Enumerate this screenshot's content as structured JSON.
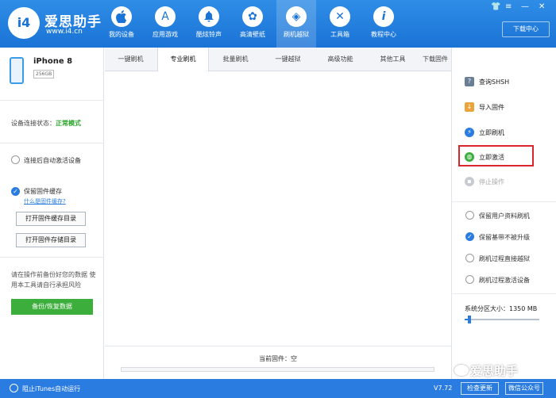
{
  "app": {
    "brand_name": "爱思助手",
    "brand_url": "www.i4.cn",
    "logo_text": "i4"
  },
  "nav": {
    "items": [
      {
        "label": "我的设备",
        "icon": "apple-icon",
        "glyph": ""
      },
      {
        "label": "应用游戏",
        "icon": "app-store-icon",
        "glyph": "A"
      },
      {
        "label": "酷炫铃声",
        "icon": "bell-icon",
        "glyph": "🔔"
      },
      {
        "label": "高清壁纸",
        "icon": "flower-icon",
        "glyph": "✿"
      },
      {
        "label": "刷机越狱",
        "icon": "dropbox-icon",
        "glyph": "◈"
      },
      {
        "label": "工具箱",
        "icon": "tools-icon",
        "glyph": "✕"
      },
      {
        "label": "教程中心",
        "icon": "info-icon",
        "glyph": "i"
      }
    ],
    "active_index": 4,
    "download_center": "下载中心"
  },
  "device": {
    "name": "iPhone 8",
    "storage": "256GB",
    "connection_label": "设备连接状态：",
    "connection_status": "正常模式"
  },
  "left_panel": {
    "auto_activate_label": "连接后自动激活设备",
    "keep_firmware_label": "保留固件缓存",
    "what_is_cache_link": "什么是固件缓存?",
    "open_cache_dir_button": "打开固件缓存目录",
    "open_storage_dir_button": "打开固件存储目录",
    "warning_text": "请在操作前备份好您的数据 使用本工具请自行承担风险",
    "backup_button": "备份/恢复数据"
  },
  "tabs": {
    "items": [
      "一键刷机",
      "专业刷机",
      "批量刷机",
      "一键越狱",
      "高级功能",
      "其他工具",
      "下载固件"
    ],
    "active_index": 1
  },
  "center": {
    "current_firmware_label": "当前固件：空",
    "progress": 0
  },
  "right_panel": {
    "actions": [
      {
        "label": "查询SHSH",
        "icon": "search-shsh-icon"
      },
      {
        "label": "导入固件",
        "icon": "import-icon"
      },
      {
        "label": "立即刷机",
        "icon": "flash-icon"
      },
      {
        "label": "立即激活",
        "icon": "globe-icon"
      },
      {
        "label": "停止操作",
        "icon": "stop-icon"
      }
    ],
    "options": [
      {
        "label": "保留用户资料刷机",
        "checked": false
      },
      {
        "label": "保留基带不被升级",
        "checked": true
      },
      {
        "label": "刷机过程直接越狱",
        "checked": false
      },
      {
        "label": "刷机过程激活设备",
        "checked": false
      }
    ],
    "partition_label": "系统分区大小：",
    "partition_value": "1350 MB",
    "partition_fraction": 0.06
  },
  "statusbar": {
    "block_itunes_label": "阻止iTunes自动运行",
    "version": "V7.72",
    "check_update": "检查更新",
    "wechat_account": "微信公众号"
  },
  "watermark": {
    "text": "爱思助手"
  },
  "colors": {
    "primary": "#2a7ce0",
    "status_ok": "#2aa52a",
    "highlight": "#d9262c",
    "backup_button": "#3cae3c"
  }
}
